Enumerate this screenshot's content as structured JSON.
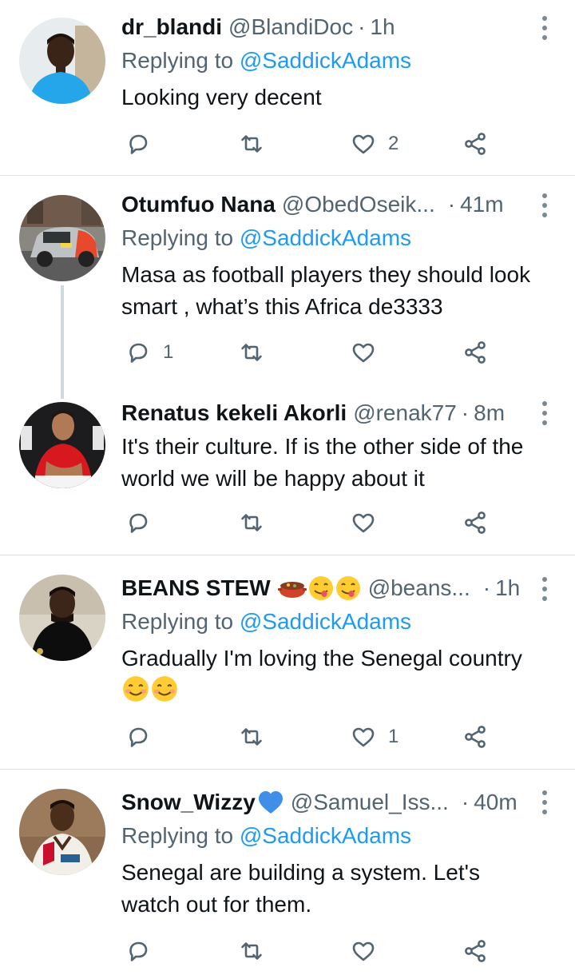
{
  "reply_prefix": "Replying to",
  "tweets": [
    {
      "name": "dr_blandi",
      "handle": "@BlandiDoc",
      "time": "1h",
      "mention": "@SaddickAdams",
      "text": "Looking very decent",
      "reply_count": "",
      "like_count": "2"
    },
    {
      "name": "Otumfuo Nana",
      "handle": "@ObedOseik",
      "time": "41m",
      "mention": "@SaddickAdams",
      "text": "Masa as football players they should look smart , what’s this Africa de3333",
      "reply_count": "1",
      "like_count": ""
    },
    {
      "name": "Renatus kekeli Akorli",
      "handle": "@renak77",
      "time": "8m",
      "text": "It's their culture. If is the other side of the world we will be happy about it",
      "reply_count": "",
      "like_count": ""
    },
    {
      "name": "BEANS STEW",
      "handle": "@beans",
      "time": "1h",
      "mention": "@SaddickAdams",
      "text": "Gradually I'm loving the Senegal country",
      "reply_count": "",
      "like_count": "1"
    },
    {
      "name": "Snow_Wizzy",
      "handle": "@Samuel_Iss",
      "time": "40m",
      "mention": "@SaddickAdams",
      "text": "Senegal are building a system. Let's watch out for them.",
      "reply_count": "",
      "like_count": ""
    }
  ],
  "ellipsis": "...",
  "dot": "·",
  "colors": {
    "link": "#1d9bf0",
    "muted": "#536471",
    "divider": "#dfe3e6",
    "text": "#0f1419"
  },
  "icons": [
    "reply-icon",
    "retweet-icon",
    "like-icon",
    "share-icon",
    "more-icon",
    "blue-heart-emoji",
    "stew-pot-emoji",
    "yummy-face-emoji",
    "smiling-face-emoji"
  ]
}
